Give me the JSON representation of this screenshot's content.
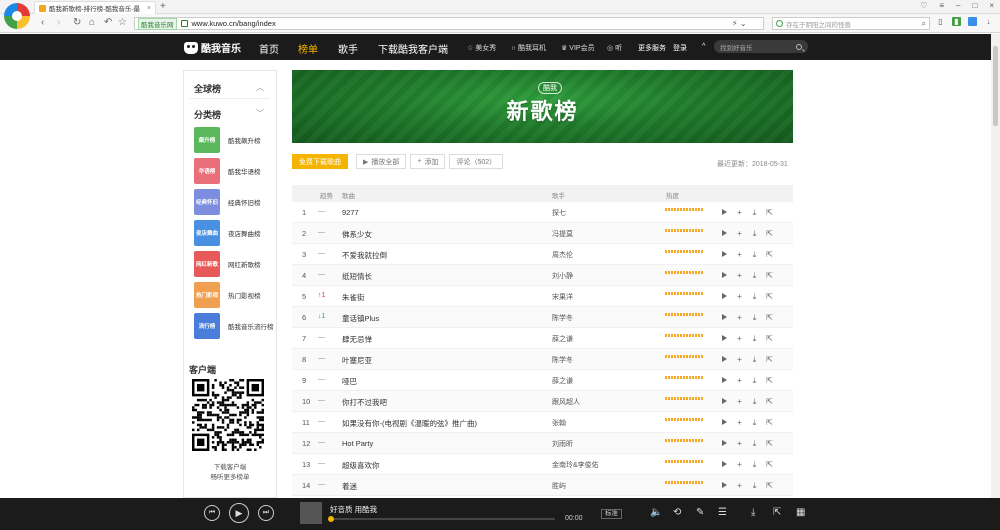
{
  "browser": {
    "tab_title": "酷我新歌榜-排行榜-酷我音乐-最",
    "new_tab": "+",
    "url_badge": "酷我音乐网",
    "url": "www.kuwo.cn/bang/index",
    "search_placeholder": "存在于阴阳之间的怪兽"
  },
  "site_nav": {
    "logo": "酷我音乐",
    "items": [
      "首页",
      "榜单",
      "歌手",
      "下载酷我客户端"
    ],
    "active": "榜单",
    "links": [
      "美女秀",
      "酷我耳机",
      "VIP会员",
      "听"
    ],
    "more": "更多服务",
    "login": "登录",
    "search_placeholder": "找到好音乐"
  },
  "sidebar": {
    "global_label": "全球榜",
    "category_label": "分类榜",
    "categories": [
      {
        "label": "酷我飙升榜",
        "thumb": "飙升榜",
        "color": "#5cb85c"
      },
      {
        "label": "酷我华语榜",
        "thumb": "华语榜",
        "color": "#e9707a"
      },
      {
        "label": "经典怀旧榜",
        "thumb": "经典怀旧",
        "color": "#7d8ee0"
      },
      {
        "label": "夜店舞曲榜",
        "thumb": "夜店舞曲",
        "color": "#4a90e2"
      },
      {
        "label": "网红新歌榜",
        "thumb": "网红新歌",
        "color": "#e85a5a"
      },
      {
        "label": "热门影视榜",
        "thumb": "热门影视",
        "color": "#f0a050"
      },
      {
        "label": "酷我音乐流行榜",
        "thumb": "流行榜",
        "color": "#4a7cd9"
      }
    ],
    "client_title": "客户端",
    "download_line1": "下载客户端",
    "download_line2": "畅听更多榜单"
  },
  "banner": {
    "logo": "酷我",
    "title": "新歌榜"
  },
  "actions": {
    "download": "免费下载歌曲",
    "play_all": "播放全部",
    "add": "添加",
    "comments": "评论（502）"
  },
  "updated": "最近更新：2018-05-31",
  "table": {
    "headers": {
      "trend": "趋势",
      "song": "歌曲",
      "artist": "歌手",
      "heat": "热度"
    },
    "rows": [
      {
        "rank": "1",
        "trend": "—",
        "dir": "flat",
        "song": "9277",
        "artist": "探七",
        "heat": 1
      },
      {
        "rank": "2",
        "trend": "—",
        "dir": "flat",
        "song": "佛系少女",
        "artist": "冯提莫",
        "heat": 1
      },
      {
        "rank": "3",
        "trend": "—",
        "dir": "flat",
        "song": "不爱我就拉倒",
        "artist": "周杰伦",
        "heat": 1
      },
      {
        "rank": "4",
        "trend": "—",
        "dir": "flat",
        "song": "纸短情长",
        "artist": "刘小静",
        "heat": 1
      },
      {
        "rank": "5",
        "trend": "↑1",
        "dir": "up",
        "song": "朱雀街",
        "artist": "宋果洋",
        "heat": 1
      },
      {
        "rank": "6",
        "trend": "↓1",
        "dir": "down",
        "song": "童话镇Plus",
        "artist": "陈学冬",
        "heat": 1
      },
      {
        "rank": "7",
        "trend": "—",
        "dir": "flat",
        "song": "肆无忌惮",
        "artist": "薛之谦",
        "heat": 1
      },
      {
        "rank": "8",
        "trend": "—",
        "dir": "flat",
        "song": "叶塞尼亚",
        "artist": "陈学冬",
        "heat": 1
      },
      {
        "rank": "9",
        "trend": "—",
        "dir": "flat",
        "song": "哑巴",
        "artist": "薛之谦",
        "heat": 1
      },
      {
        "rank": "10",
        "trend": "—",
        "dir": "flat",
        "song": "你打不过我吧",
        "artist": "跟风超人",
        "heat": 1
      },
      {
        "rank": "11",
        "trend": "—",
        "dir": "flat",
        "song": "如果没有你-(电视剧《温暖的弦》推广曲)",
        "artist": "张翰",
        "heat": 1
      },
      {
        "rank": "12",
        "trend": "—",
        "dir": "flat",
        "song": "Hot Party",
        "artist": "刘雨昕",
        "heat": 1
      },
      {
        "rank": "13",
        "trend": "—",
        "dir": "flat",
        "song": "超级喜欢你",
        "artist": "金南玲&李俊佑",
        "heat": 1
      },
      {
        "rank": "14",
        "trend": "—",
        "dir": "flat",
        "song": "着迷",
        "artist": "胜屿",
        "heat": 1
      }
    ]
  },
  "player": {
    "now_playing": "好音质 用酷我",
    "time": "00:00",
    "quality": "标准",
    "progress": 0
  }
}
